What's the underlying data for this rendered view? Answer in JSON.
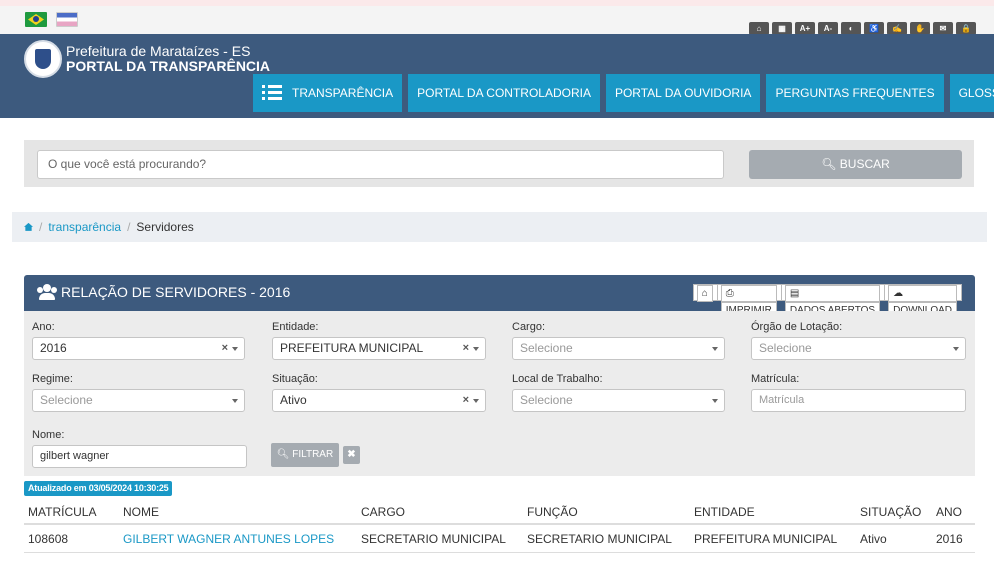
{
  "topbar": {
    "flags": [
      "brazil-flag",
      "espirito-santo-flag"
    ],
    "accessibility": [
      "home-icon",
      "map-icon",
      "font-increase-icon",
      "font-decrease-icon",
      "contrast-icon",
      "wheelchair-icon",
      "sign-language-icon",
      "hand-icon",
      "mail-icon",
      "lock-icon"
    ],
    "acc_glyphs": [
      "⌂",
      "▦",
      "A+",
      "A-",
      "◐",
      "♿",
      "✍",
      "✋",
      "✉",
      "🔒"
    ]
  },
  "header": {
    "title_line1": "Prefeitura de Marataízes - ES",
    "title_line2": "PORTAL DA TRANSPARÊNCIA",
    "nav": [
      "TRANSPARÊNCIA",
      "PORTAL DA CONTROLADORIA",
      "PORTAL DA OUVIDORIA",
      "PERGUNTAS FREQUENTES",
      "GLOSSÁRIO"
    ]
  },
  "search": {
    "placeholder": "O que você está procurando?",
    "button": "BUSCAR"
  },
  "breadcrumb": {
    "link": "transparência",
    "current": "Servidores"
  },
  "panel": {
    "title": "RELAÇÃO DE SERVIDORES - 2016",
    "buttons": {
      "print": "IMPRIMIR",
      "open_data": "DADOS ABERTOS",
      "download": "DOWNLOAD"
    }
  },
  "filters": {
    "ano": {
      "label": "Ano:",
      "value": "2016"
    },
    "entidade": {
      "label": "Entidade:",
      "value": "PREFEITURA MUNICIPAL"
    },
    "cargo": {
      "label": "Cargo:",
      "value": "Selecione"
    },
    "orgao": {
      "label": "Órgão de Lotação:",
      "value": "Selecione"
    },
    "regime": {
      "label": "Regime:",
      "value": "Selecione"
    },
    "situacao": {
      "label": "Situação:",
      "value": "Ativo"
    },
    "local": {
      "label": "Local de Trabalho:",
      "value": "Selecione"
    },
    "matricula": {
      "label": "Matrícula:",
      "placeholder": "Matrícula"
    },
    "nome": {
      "label": "Nome:",
      "value": "gilbert wagner"
    },
    "filter_button": "FILTRAR"
  },
  "updated": "Atualizado em 03/05/2024 10:30:25",
  "table": {
    "columns": [
      "MATRÍCULA",
      "NOME",
      "CARGO",
      "FUNÇÃO",
      "ENTIDADE",
      "SITUAÇÃO",
      "ANO"
    ],
    "rows": [
      [
        "108608",
        "GILBERT WAGNER ANTUNES LOPES",
        "SECRETARIO MUNICIPAL",
        "SECRETARIO MUNICIPAL",
        "PREFEITURA MUNICIPAL",
        "Ativo",
        "2016"
      ]
    ]
  }
}
